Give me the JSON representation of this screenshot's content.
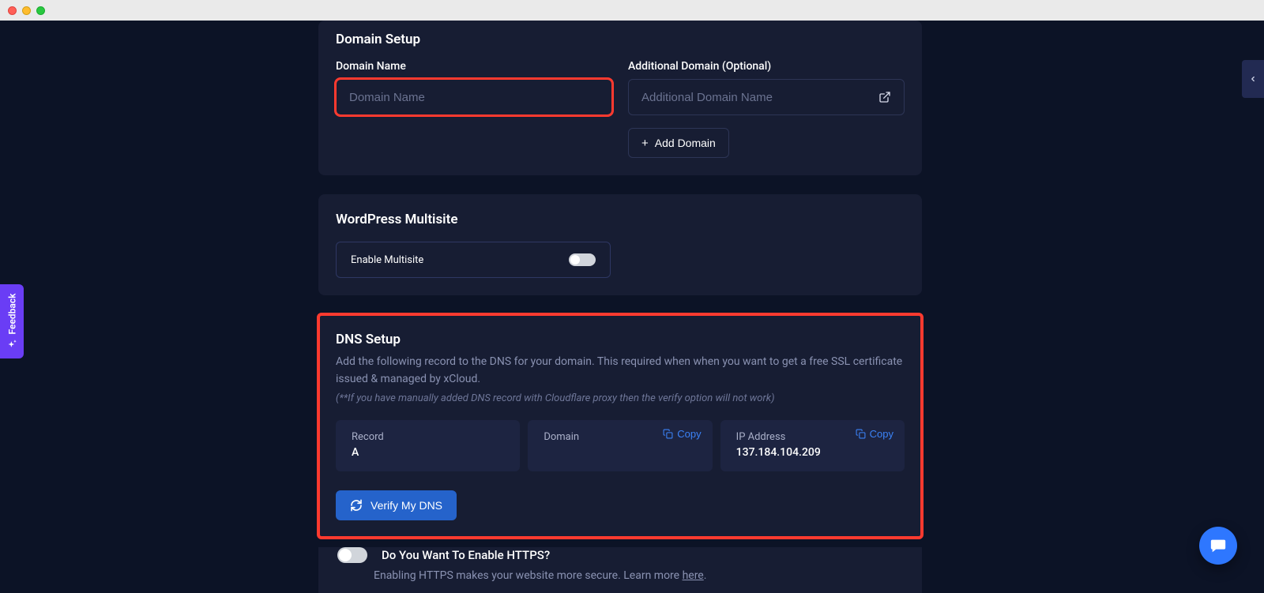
{
  "domainSetup": {
    "title": "Domain Setup",
    "domainName": {
      "label": "Domain Name",
      "placeholder": "Domain Name",
      "value": ""
    },
    "additionalDomain": {
      "label": "Additional Domain (Optional)",
      "placeholder": "Additional Domain Name",
      "value": ""
    },
    "addDomainLabel": "Add Domain"
  },
  "multisite": {
    "title": "WordPress Multisite",
    "enableLabel": "Enable Multisite"
  },
  "dns": {
    "title": "DNS Setup",
    "description": "Add the following record to the DNS for your domain. This required when when you want to get a free SSL certificate issued & managed by xCloud.",
    "note": "(**If you have manually added DNS record with Cloudflare proxy then the verify option will not work)",
    "record": {
      "label": "Record",
      "value": "A"
    },
    "domain": {
      "label": "Domain",
      "value": "",
      "copyLabel": "Copy"
    },
    "ip": {
      "label": "IP Address",
      "value": "137.184.104.209",
      "copyLabel": "Copy"
    },
    "verifyLabel": "Verify My DNS"
  },
  "https": {
    "question": "Do You Want To Enable HTTPS?",
    "subPrefix": "Enabling HTTPS makes your website more secure. Learn more ",
    "hereLabel": "here"
  },
  "feedback": {
    "label": "Feedback"
  }
}
